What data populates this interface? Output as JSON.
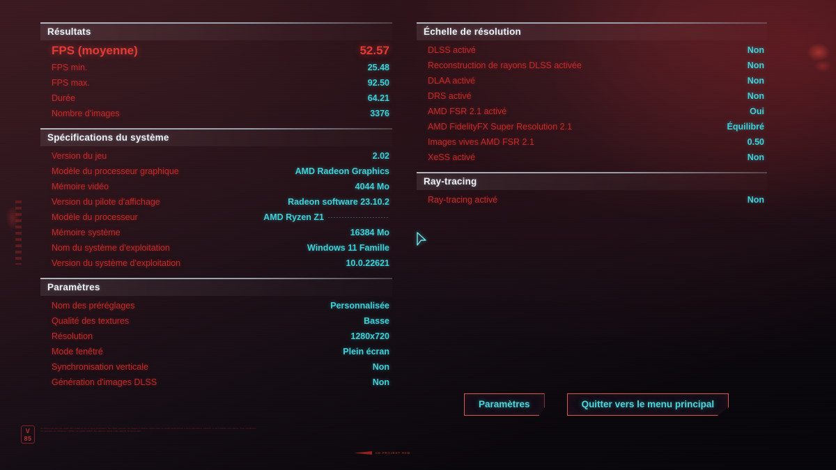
{
  "colors": {
    "label_red": "#c02c2c",
    "value_cyan": "#3fd0d8",
    "hero_red": "#e23b36",
    "header_text": "#eef2f5",
    "button_border": "#d05a55",
    "background_top": "#3b1b21",
    "background_bottom": "#07060a"
  },
  "left_column": {
    "sections": [
      {
        "title": "Résultats",
        "rows": [
          {
            "label": "FPS (moyenne)",
            "value": "52.57",
            "hero": true
          },
          {
            "label": "FPS min.",
            "value": "25.48"
          },
          {
            "label": "FPS max.",
            "value": "92.50"
          },
          {
            "label": "Durée",
            "value": "64.21"
          },
          {
            "label": "Nombre d'images",
            "value": "3376"
          }
        ]
      },
      {
        "title": "Spécifications du système",
        "rows": [
          {
            "label": "Version du jeu",
            "value": "2.02"
          },
          {
            "label": "Modèle du processeur graphique",
            "value": "AMD Radeon Graphics"
          },
          {
            "label": "Mémoire vidéo",
            "value": "4044 Mo"
          },
          {
            "label": "Version du pilote d'affichage",
            "value": "Radeon software 23.10.2"
          },
          {
            "label": "Modèle du processeur",
            "value": "AMD Ryzen Z1",
            "trailing_dots": true
          },
          {
            "label": "Mémoire système",
            "value": "16384 Mo"
          },
          {
            "label": "Nom du système d'exploitation",
            "value": "Windows 11 Famille"
          },
          {
            "label": "Version du système d'exploitation",
            "value": "10.0.22621"
          }
        ]
      },
      {
        "title": "Paramètres",
        "rows": [
          {
            "label": "Nom des préréglages",
            "value": "Personnalisée"
          },
          {
            "label": "Qualité des textures",
            "value": "Basse"
          },
          {
            "label": "Résolution",
            "value": "1280x720"
          },
          {
            "label": "Mode fenêtré",
            "value": "Plein écran"
          },
          {
            "label": "Synchronisation verticale",
            "value": "Non"
          },
          {
            "label": "Génération d'images DLSS",
            "value": "Non"
          }
        ]
      }
    ]
  },
  "right_column": {
    "sections": [
      {
        "title": "Échelle de résolution",
        "rows": [
          {
            "label": "DLSS activé",
            "value": "Non"
          },
          {
            "label": "Reconstruction de rayons DLSS activée",
            "value": "Non"
          },
          {
            "label": "DLAA activé",
            "value": "Non"
          },
          {
            "label": "DRS activé",
            "value": "Non"
          },
          {
            "label": "AMD FSR 2.1 activé",
            "value": "Oui"
          },
          {
            "label": "AMD FidelityFX Super Resolution 2.1",
            "value": "Équilibré"
          },
          {
            "label": "Images vives AMD FSR 2.1",
            "value": "0.50"
          },
          {
            "label": "XeSS activé",
            "value": "Non"
          }
        ]
      },
      {
        "title": "Ray-tracing",
        "rows": [
          {
            "label": "Ray-tracing activé",
            "value": "Non"
          }
        ]
      }
    ]
  },
  "buttons": [
    {
      "label": "Paramètres",
      "name": "settings-button"
    },
    {
      "label": "Quitter vers le menu principal",
      "name": "quit-to-main-menu-button"
    }
  ],
  "decor": {
    "version_badge_line1": "V",
    "version_badge_line2": "85",
    "legal_microtext": "Ce contenu ne peut pas encore être évalué ou est en cours d'évaluation. Tous droits réservés. Les images et marques figurant dans ce produit appartiennent à leurs propriétaires respectifs et sont utilisées sous licence. Toute reproduction non autorisée est strictement interdite. Ce logiciel contient des éléments soumis à des accords de licence tiers.",
    "footer_mark": "CD PROJEKT RED",
    "cursor_icon": "arrow-cursor"
  }
}
